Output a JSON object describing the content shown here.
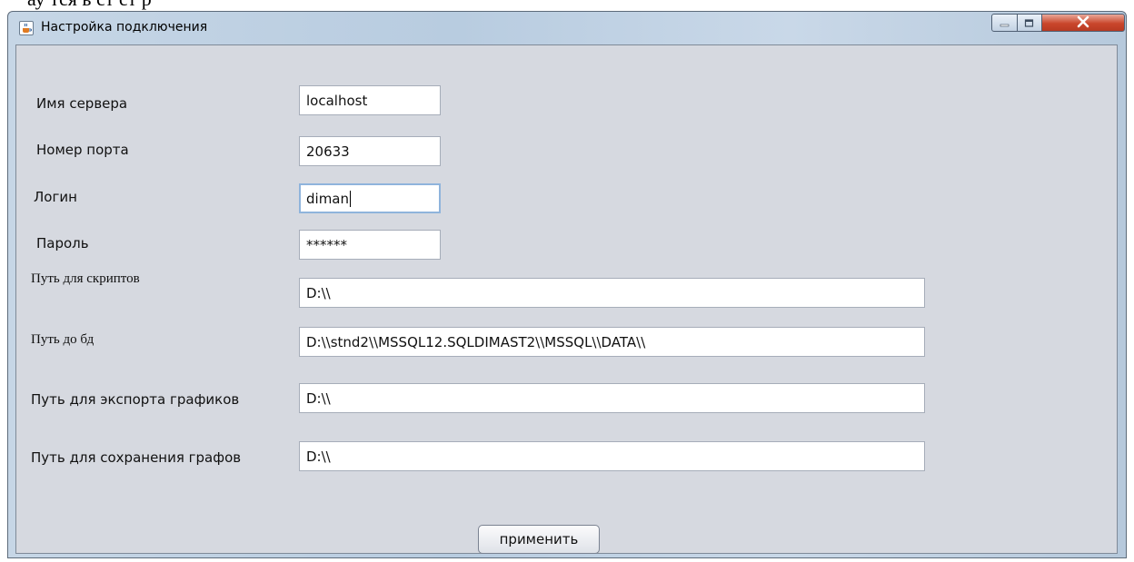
{
  "document": {
    "top_text": "ау   тся     ь    ст    ст    р"
  },
  "window": {
    "title": "Настройка подключения",
    "icon": "java-cup-icon",
    "controls": [
      "minimize-icon",
      "maximize-icon",
      "close-icon"
    ]
  },
  "form": {
    "server_name": {
      "label": "Имя сервера",
      "value": "localhost"
    },
    "port": {
      "label": "Номер порта",
      "value": "20633"
    },
    "login": {
      "label": "Логин",
      "value": "diman"
    },
    "password": {
      "label": "Пароль",
      "value": "******"
    },
    "scripts_path": {
      "label": "Путь для скриптов",
      "value": "D:\\\\"
    },
    "db_path": {
      "label": "Путь до бд",
      "value": "D:\\\\stnd2\\\\MSSQL12.SQLDIMAST2\\\\MSSQL\\\\DATA\\\\"
    },
    "charts_export_path": {
      "label": "Путь для экспорта графиков",
      "value": "D:\\\\"
    },
    "graphs_save_path": {
      "label": "Путь для сохранения графов",
      "value": "D:\\\\"
    }
  },
  "apply_button": {
    "label": "применить"
  }
}
